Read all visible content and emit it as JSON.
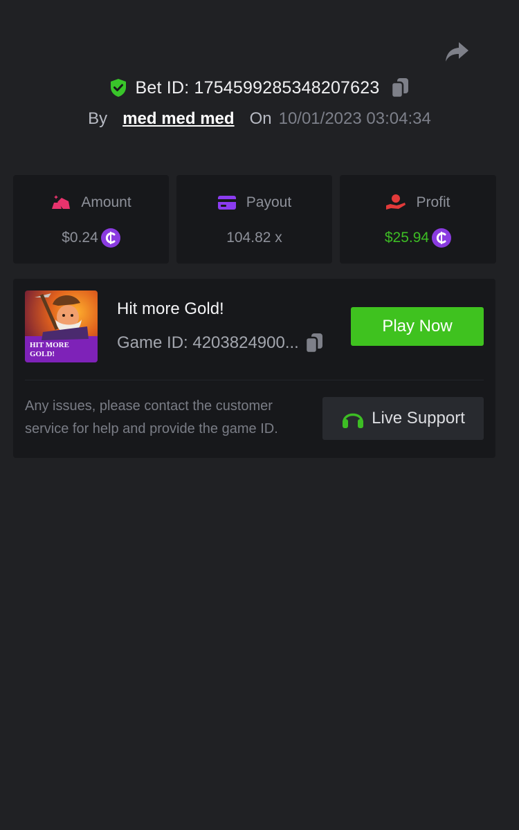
{
  "header": {
    "bet_id": "Bet ID: 1754599285348207623",
    "by_label": "By",
    "username": "med med med",
    "on_label": "On",
    "datetime": "10/01/2023 03:04:34"
  },
  "stats": [
    {
      "label": "Amount",
      "value": "$0.24",
      "icon": "gold-bar-icon",
      "has_coin": true
    },
    {
      "label": "Payout",
      "value": "104.82 x",
      "icon": "card-icon",
      "has_coin": false
    },
    {
      "label": "Profit",
      "value": "$25.94",
      "icon": "hand-coin-icon",
      "has_coin": true
    }
  ],
  "game": {
    "thumbnail_text": "HIT MORE GOLD!",
    "name": "Hit more Gold!",
    "game_id": "Game ID: 4203824900...",
    "play_label": "Play Now"
  },
  "support": {
    "text": "Any issues, please contact the customer service for help and provide the game ID.",
    "button_label": "Live Support"
  },
  "colors": {
    "background": "#202124",
    "card": "#17181b",
    "accent_green": "#3fc21f",
    "profit_green": "#3dbd24",
    "coin_purple": "#8a3be0",
    "pink": "#e8336d",
    "purple": "#8b3cf0",
    "red": "#e23a3a"
  }
}
